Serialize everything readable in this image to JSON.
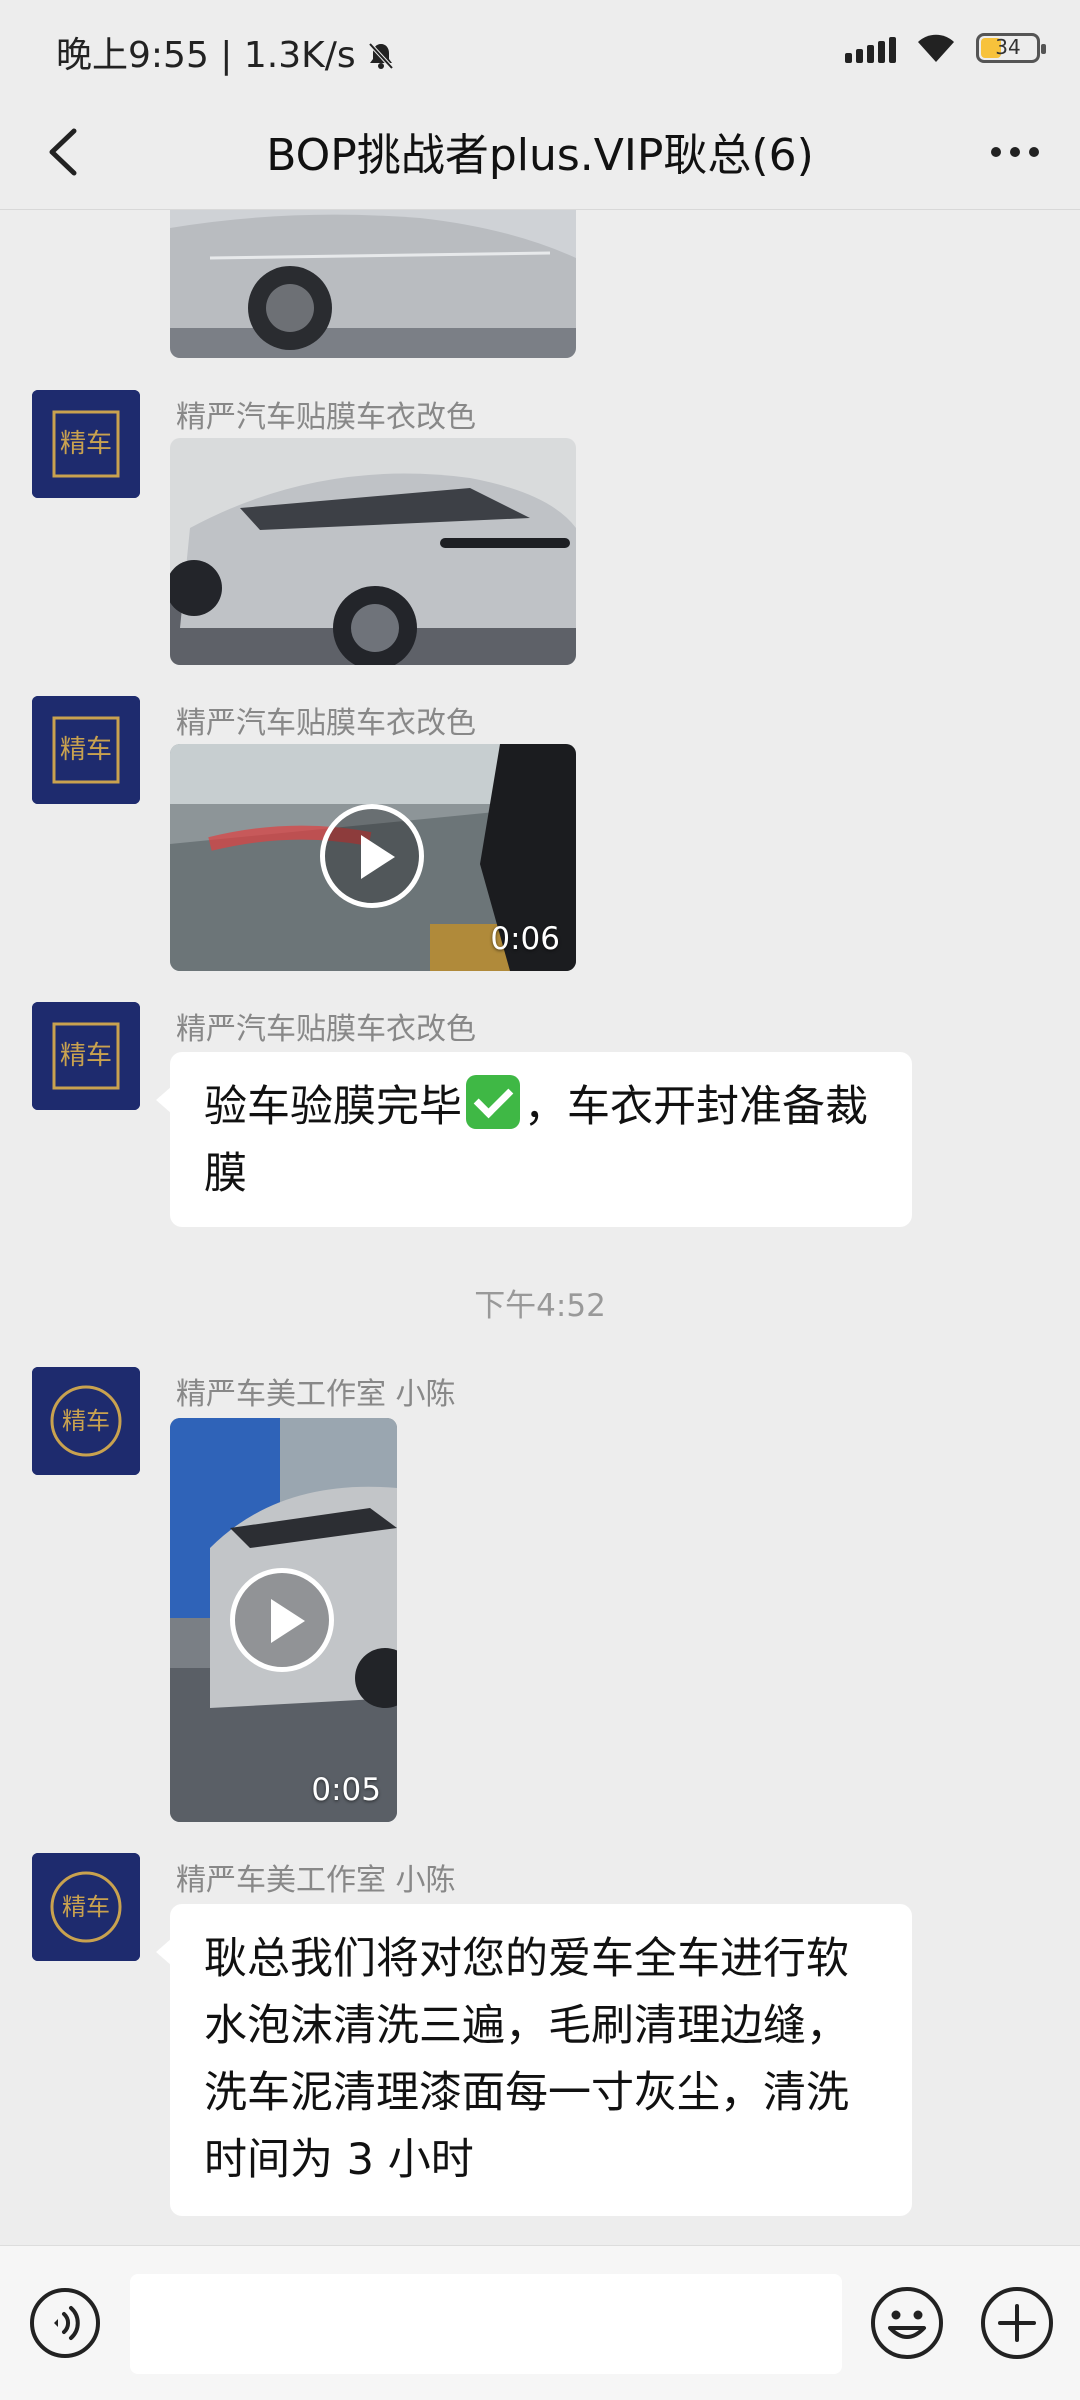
{
  "status_bar": {
    "time_text": "晚上9:55 | 1.3K/s",
    "icons": [
      "mute-bell-icon",
      "signal-icon",
      "wifi-icon",
      "battery-icon"
    ],
    "battery_level": "34"
  },
  "nav": {
    "title": "BOP挑战者plus.VIP耿总(6)",
    "back_icon": "chevron-left-icon",
    "more_icon": "more-dots-icon"
  },
  "messages": [
    {
      "type": "image",
      "sender": ""
    },
    {
      "type": "image",
      "sender": "精严汽车贴膜车衣改色"
    },
    {
      "type": "video",
      "sender": "精严汽车贴膜车衣改色",
      "duration": "0:06"
    },
    {
      "type": "text",
      "sender": "精严汽车贴膜车衣改色",
      "text_line1": "验车验膜完毕",
      "text_line1b": "，车衣开封准备裁",
      "text_line2": "膜"
    },
    {
      "type": "timestamp",
      "text": "下午4:52"
    },
    {
      "type": "video",
      "sender": "精严车美工作室 小陈",
      "duration": "0:05"
    },
    {
      "type": "text",
      "sender": "精严车美工作室 小陈",
      "lines": [
        "耿总我们将对您的爱车全车进行软",
        "水泡沫清洗三遍，毛刷清理边缝，",
        "洗车泥清理漆面每一寸灰尘，清洗",
        "时间为 3 小时"
      ]
    }
  ],
  "input_bar": {
    "voice_icon": "voice-icon",
    "emoji_icon": "emoji-icon",
    "plus_icon": "plus-icon",
    "text_value": ""
  },
  "colors": {
    "background": "#ededed",
    "bubble": "#ffffff",
    "avatar": "#1e2b6e",
    "check": "#3fb845",
    "battery": "#f7c23b"
  }
}
